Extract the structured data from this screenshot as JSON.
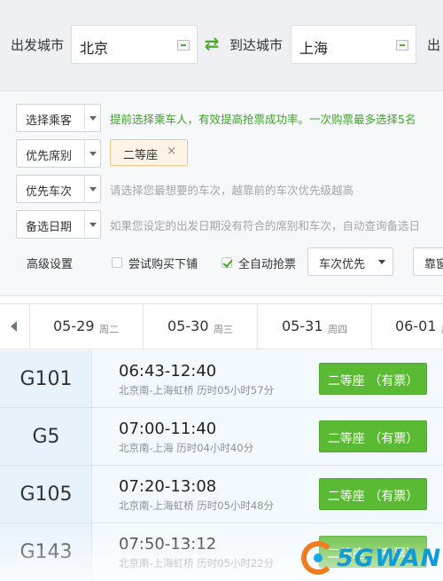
{
  "search": {
    "from_label": "出发城市",
    "from_value": "北京",
    "to_label": "到达城市",
    "to_value": "上海",
    "date_label_partial": "出"
  },
  "options": {
    "passenger_select": "选择乘客",
    "passenger_hint": "提前选择乘车人，有效提高抢票成功率。一次购票最多选择5名",
    "seat_select": "优先席别",
    "seat_tag": "二等座",
    "seat_tag_remove": "×",
    "train_select": "优先车次",
    "train_hint": "请选择您最想要的车次，越靠前的车次优先级越高",
    "date_select": "备选日期",
    "date_hint": "如果您设定的出发日期没有符合的席别和车次，自动查询备选日",
    "advanced_label": "高级设置",
    "try_lower_berth": "尝试购买下铺",
    "try_lower_berth_checked": false,
    "auto_grab": "全自动抢票",
    "auto_grab_checked": true,
    "priority_dropdown": "车次优先",
    "window_partial": "靠窗"
  },
  "dates": [
    {
      "date": "05-29",
      "weekday": "周二"
    },
    {
      "date": "05-30",
      "weekday": "周三"
    },
    {
      "date": "05-31",
      "weekday": "周四"
    },
    {
      "date": "06-01",
      "weekday": "周"
    }
  ],
  "trains": [
    {
      "number": "G101",
      "time": "06:43-12:40",
      "route": "北京南-上海虹桥 历时05小时57分",
      "seat": "二等座 （有票）"
    },
    {
      "number": "G5",
      "time": "07:00-11:40",
      "route": "北京南-上海 历时04小时40分",
      "seat": "二等座 （有票）"
    },
    {
      "number": "G105",
      "time": "07:20-13:08",
      "route": "北京南-上海虹桥 历时05小时48分",
      "seat": "二等座 （有票）"
    },
    {
      "number": "G143",
      "time": "07:50-13:12",
      "route": "北京南-上海虹桥 历时05小时22分",
      "seat": "二等座 （有票）"
    }
  ],
  "watermark": "5GWAN",
  "colors": {
    "accent_green": "#5bba33",
    "hint_green": "#3fa52a",
    "tag_bg": "#fff4e6",
    "row_bg": "#f3f9fe"
  }
}
